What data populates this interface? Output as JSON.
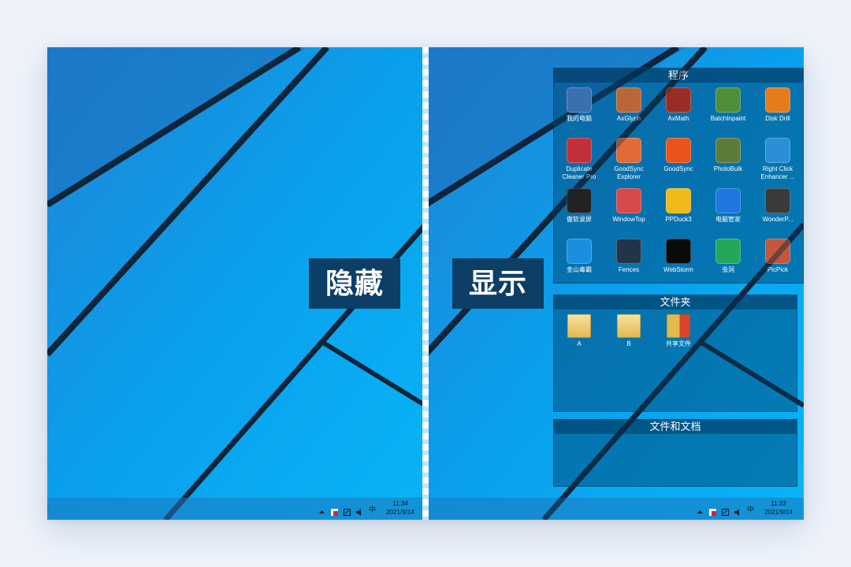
{
  "labels": {
    "hidden": "隐藏",
    "shown": "显示"
  },
  "left_taskbar": {
    "time": "11:34",
    "date": "2021/9/14",
    "ime": "中"
  },
  "right_taskbar": {
    "time": "11:33",
    "date": "2021/9/14",
    "ime": "中"
  },
  "tray_icons": [
    "tray-arrow-icon",
    "security-icon",
    "network-icon",
    "volume-icon"
  ],
  "fences": {
    "programs": {
      "title": "程序",
      "apps": [
        {
          "label": "我的电脑",
          "icon": "computer-icon",
          "color": "#3a6fb0"
        },
        {
          "label": "AxGlyph",
          "icon": "axglyph-icon",
          "color": "#b8663a"
        },
        {
          "label": "AxMath",
          "icon": "axmath-icon",
          "color": "#9b2b25"
        },
        {
          "label": "BatchInpaint",
          "icon": "batchinpaint-icon",
          "color": "#4f8f3c"
        },
        {
          "label": "Disk Drill",
          "icon": "diskdrill-icon",
          "color": "#e47c1e"
        },
        {
          "label": "Duplicate\nCleaner Pro",
          "icon": "duplicate-cleaner-icon",
          "color": "#c2303a"
        },
        {
          "label": "GoodSync\nExplorer",
          "icon": "goodsync-explorer-icon",
          "color": "#e06b38"
        },
        {
          "label": "GoodSync",
          "icon": "goodsync-icon",
          "color": "#e8541c"
        },
        {
          "label": "PhotoBulk",
          "icon": "photobulk-icon",
          "color": "#5c7c3c"
        },
        {
          "label": "Right Click\nEnhancer ...",
          "icon": "right-click-enhancer-icon",
          "color": "#2a8fd6"
        },
        {
          "label": "傲软录屏",
          "icon": "screen-recorder-icon",
          "color": "#222222"
        },
        {
          "label": "WindowTop",
          "icon": "windowtop-icon",
          "color": "#d84a4a"
        },
        {
          "label": "PPDuck3",
          "icon": "ppduck-icon",
          "color": "#f2b91b"
        },
        {
          "label": "电脑管家",
          "icon": "pc-manager-icon",
          "color": "#1f77e0"
        },
        {
          "label": "WonderP...",
          "icon": "wonderpen-icon",
          "color": "#3a3a3a"
        },
        {
          "label": "金山毒霸",
          "icon": "duba-icon",
          "color": "#1c8ee0"
        },
        {
          "label": "Fences",
          "icon": "fences-icon",
          "color": "#243447"
        },
        {
          "label": "WebStorm",
          "icon": "webstorm-icon",
          "color": "#0a0a0a"
        },
        {
          "label": "虫洞",
          "icon": "wormhole-icon",
          "color": "#23a85a"
        },
        {
          "label": "PicPick",
          "icon": "picpick-icon",
          "color": "#c2573a"
        }
      ]
    },
    "folders": {
      "title": "文件夹",
      "items": [
        {
          "label": "A",
          "icon": "folder-icon"
        },
        {
          "label": "B",
          "icon": "folder-icon"
        },
        {
          "label": "共享文件",
          "icon": "shared-folder-icon"
        }
      ]
    },
    "docs": {
      "title": "文件和文档"
    }
  }
}
